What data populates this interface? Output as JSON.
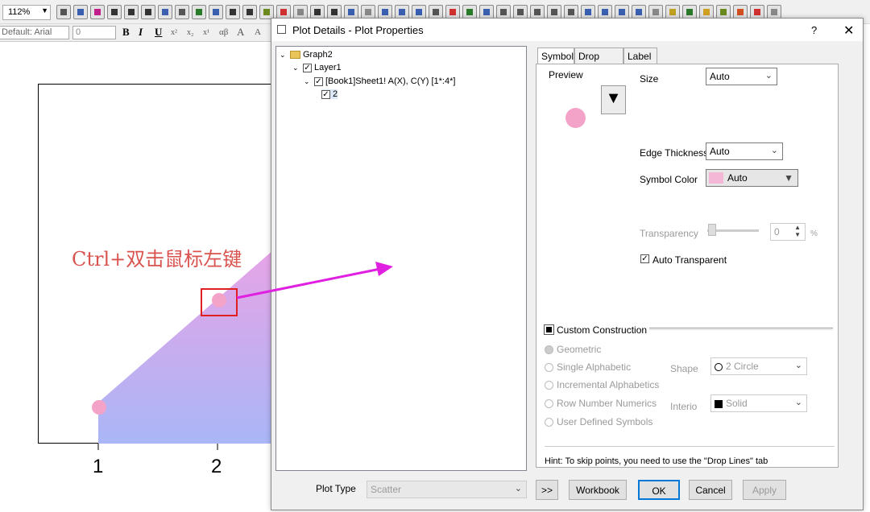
{
  "toolbar": {
    "zoom": "112%",
    "font": "Default: Arial",
    "size": "0"
  },
  "graph": {
    "xticks": [
      "1",
      "2"
    ],
    "annotation": "Ctrl+双击鼠标左键",
    "colors": {
      "fill_top": "#e7a4e6",
      "fill_bottom": "#a9b6f7",
      "point": "#f4a3c8",
      "annotation": "#d9534f",
      "arrow": "#e020e0"
    }
  },
  "dialog": {
    "title": "Plot Details - Plot Properties",
    "help": "?",
    "close": "✕",
    "tree": [
      {
        "label": "Graph2"
      },
      {
        "label": "Layer1"
      },
      {
        "label": "[Book1]Sheet1! A(X), C(Y) [1*:4*]"
      },
      {
        "label": "2"
      }
    ],
    "tabs": [
      "Symbol",
      "Drop Lines",
      "Label"
    ],
    "symbol": {
      "preview_label": "Preview",
      "size_label": "Size",
      "size_value": "Auto",
      "edge_label": "Edge Thickness",
      "edge_value": "Auto",
      "color_label": "Symbol Color",
      "color_value": "Auto",
      "transparency_label": "Transparency",
      "transparency_value": "0",
      "percent": "%",
      "auto_transparent": "Auto Transparent",
      "custom_construction": "Custom Construction",
      "options": [
        "Geometric",
        "Single Alphabetic",
        "Incremental Alphabetics",
        "Row Number Numerics",
        "User Defined Symbols"
      ],
      "shape_label": "Shape",
      "shape_value": "2 Circle",
      "interior_label": "Interio",
      "interior_value": "Solid",
      "hint": "Hint: To skip points, you need to use the \"Drop Lines\" tab"
    },
    "plot_type_label": "Plot Type",
    "plot_type_value": "Scatter",
    "buttons": {
      "expand": ">>",
      "workbook": "Workbook",
      "ok": "OK",
      "cancel": "Cancel",
      "apply": "Apply"
    }
  }
}
